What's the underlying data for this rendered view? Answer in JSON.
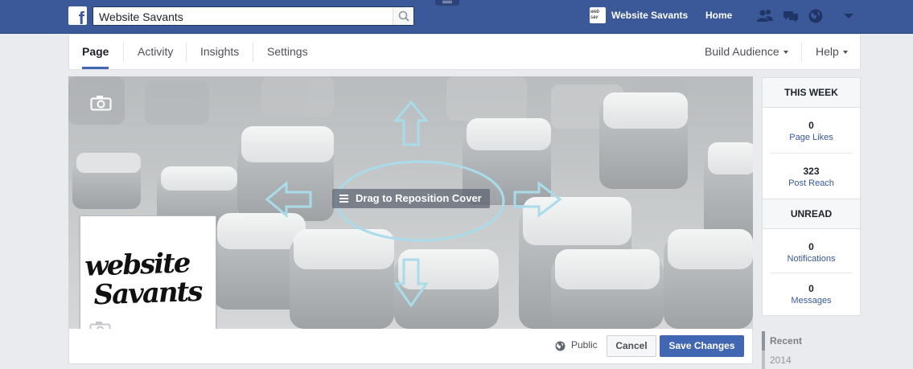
{
  "topbar": {
    "search_value": "Website Savants",
    "profile_name": "Website Savants",
    "home_label": "Home",
    "icons": [
      "facebook-logo",
      "search-icon",
      "friend-requests-icon",
      "messages-icon",
      "notifications-globe-icon",
      "account-menu-caret-icon"
    ]
  },
  "page_nav": {
    "tabs": [
      {
        "label": "Page"
      },
      {
        "label": "Activity"
      },
      {
        "label": "Insights"
      },
      {
        "label": "Settings"
      }
    ],
    "build_audience": "Build Audience",
    "help": "Help"
  },
  "cover": {
    "drag_label": "Drag to Reposition Cover"
  },
  "profile_picture": {
    "logo_line1": "website",
    "logo_line2": "Savants"
  },
  "cover_bar": {
    "privacy": "Public",
    "cancel": "Cancel",
    "save": "Save Changes"
  },
  "stats": {
    "this_week": "THIS WEEK",
    "page_likes_value": "0",
    "page_likes_label": "Page Likes",
    "post_reach_value": "323",
    "post_reach_label": "Post Reach",
    "unread": "UNREAD",
    "notifications_value": "0",
    "notifications_label": "Notifications",
    "messages_value": "0",
    "messages_label": "Messages"
  },
  "timeline": {
    "recent": "Recent",
    "year": "2014"
  },
  "colors": {
    "brand_blue": "#3b5998",
    "button_blue": "#4267b2",
    "annotation_blue": "#a9dcea"
  }
}
